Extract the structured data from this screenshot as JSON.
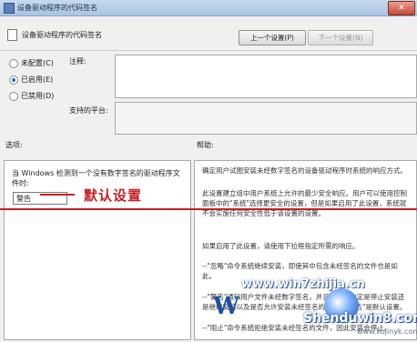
{
  "window": {
    "title": "设备驱动程序的代码签名",
    "close_glyph": "✕"
  },
  "header": {
    "title": "设备驱动程序的代码签名",
    "prev_label": "上一个设置(P)",
    "next_label": "下一个设置(N)"
  },
  "state": {
    "options": [
      {
        "label": "未配置(C)",
        "selected": false
      },
      {
        "label": "已启用(E)",
        "selected": true
      },
      {
        "label": "已禁用(D)",
        "selected": false
      }
    ]
  },
  "fields": {
    "comment_label": "注释:",
    "platform_label": "支持的平台:"
  },
  "sections": {
    "options_label": "选项:",
    "help_label": "帮助:"
  },
  "option_panel": {
    "description": "当 Windows 检测到一个没有数字签名的驱动程序文件时:",
    "select_value": "警告"
  },
  "help": {
    "paragraphs": [
      "确定用户试图安装未经数字签名的设备驱动程序时系统的响应方式。",
      "此设置建立组中用户系统上允许的最少安全响应。用户可以使用控制面板中的\"系统\"选择更安全的设置，但是如果启用了此设置，系统就不会实施任何安全性低于该设置的设置。",
      "如果启用了此设置，请使用下拉框指定所需的响应。",
      "--\"忽略\"命令系统继续安装，即使其中包含未经签名的文件也是如此。",
      "--\"警告\"通知用户文件未经数字签名，并且让用户决定是停止安装还是继续安装以及是否允许安装未经签名的文件。\"警告\"是默认设置。",
      "--\"阻止\"命令系统拒绝安装未经签名的文件，因此安装会停止。"
    ]
  },
  "annotation": {
    "text": "默认设置"
  },
  "watermark": {
    "url": "www.win7zhijia.cn",
    "logo_letter": "W",
    "brand": "Shenduwin8.com",
    "site": "www.kojinyk.com"
  },
  "colors": {
    "annotation": "#c72020",
    "accent": "#2d6bc8"
  }
}
